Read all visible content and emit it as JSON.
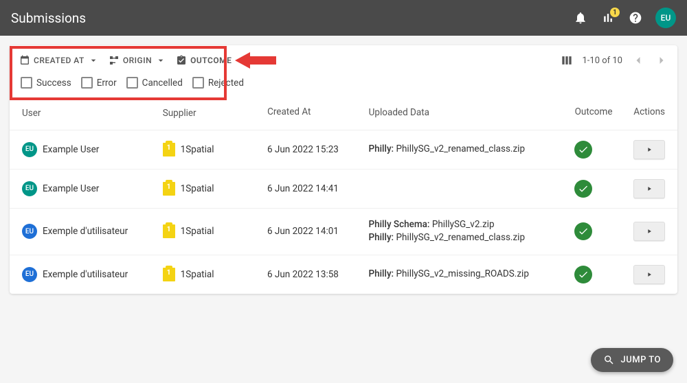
{
  "page_title": "Submissions",
  "header": {
    "analytics_badge": "1",
    "user_initials": "EU"
  },
  "filters": {
    "created_at": "CREATED AT",
    "origin": "ORIGIN",
    "outcome": "OUTCOME",
    "outcome_options": {
      "success": "Success",
      "error": "Error",
      "cancelled": "Cancelled",
      "rejected": "Rejected"
    }
  },
  "pagination": "1-10 of 10",
  "columns": {
    "user": "User",
    "supplier": "Supplier",
    "created_at": "Created At",
    "uploaded_data": "Uploaded Data",
    "outcome": "Outcome",
    "actions": "Actions"
  },
  "rows": [
    {
      "avatar_initials": "EU",
      "avatar_color": "green",
      "user": "Example User",
      "supplier": "1Spatial",
      "created_at": "6 Jun 2022 15:23",
      "uploaded_label_1": "Philly: ",
      "uploaded_value_1": "PhillySG_v2_renamed_class.zip"
    },
    {
      "avatar_initials": "EU",
      "avatar_color": "green",
      "user": "Example User",
      "supplier": "1Spatial",
      "created_at": "6 Jun 2022 14:41"
    },
    {
      "avatar_initials": "EU",
      "avatar_color": "blue",
      "user": "Exemple d'utilisateur",
      "supplier": "1Spatial",
      "created_at": "6 Jun 2022 14:01",
      "uploaded_label_1": "Philly Schema: ",
      "uploaded_value_1": "PhillySG_v2.zip",
      "uploaded_label_2": "Philly: ",
      "uploaded_value_2": "PhillySG_v2_renamed_class.zip"
    },
    {
      "avatar_initials": "EU",
      "avatar_color": "blue",
      "user": "Exemple d'utilisateur",
      "supplier": "1Spatial",
      "created_at": "6 Jun 2022 13:58",
      "uploaded_label_1": "Philly: ",
      "uploaded_value_1": "PhillySG_v2_missing_ROADS.zip"
    }
  ],
  "jump_to": "JUMP TO"
}
